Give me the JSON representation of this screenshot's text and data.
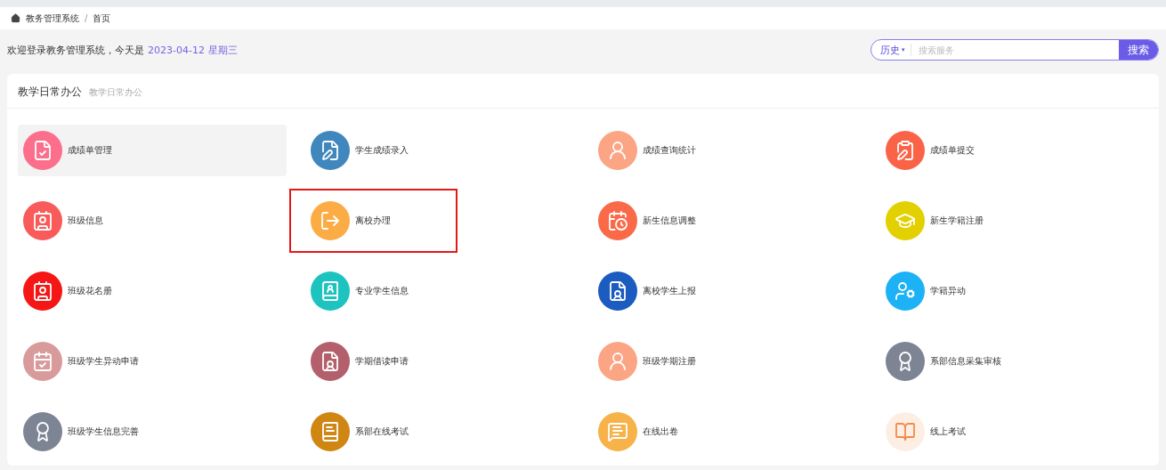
{
  "breadcrumb": [
    "教务管理系统",
    "首页"
  ],
  "breadcrumb_separator": "/",
  "welcome": {
    "text": "欢迎登录教务管理系统，今天是",
    "date": "2023-04-12",
    "weekday": "星期三"
  },
  "search": {
    "history": "历史",
    "history_caret": "▾",
    "placeholder": "搜索服务",
    "button": "搜索"
  },
  "section": {
    "title": "教学日常办公",
    "subtitle": "教学日常办公",
    "items": [
      {
        "label": "成绩单管理",
        "kind": "doc-check",
        "color": "#fb6e8c",
        "hovered": true,
        "highlighted": false
      },
      {
        "label": "学生成绩录入",
        "kind": "doc-pen",
        "color": "#3f87bd",
        "hovered": false,
        "highlighted": false
      },
      {
        "label": "成绩查询统计",
        "kind": "user-list",
        "color": "#fba584",
        "hovered": false,
        "highlighted": false
      },
      {
        "label": "成绩单提交",
        "kind": "clipboard-pen",
        "color": "#fb6349",
        "hovered": false,
        "highlighted": false
      },
      {
        "label": "班级信息",
        "kind": "contact",
        "color": "#f95a5a",
        "hovered": false,
        "highlighted": false
      },
      {
        "label": "离校办理",
        "kind": "user-exit",
        "color": "#fbac45",
        "hovered": false,
        "highlighted": true
      },
      {
        "label": "新生信息调整",
        "kind": "calendar-badge",
        "color": "#fb6a48",
        "hovered": false,
        "highlighted": false
      },
      {
        "label": "新生学籍注册",
        "kind": "graduation",
        "color": "#e2d000",
        "hovered": false,
        "highlighted": false
      },
      {
        "label": "班级花名册",
        "kind": "contact",
        "color": "#f51616",
        "hovered": false,
        "highlighted": false
      },
      {
        "label": "专业学生信息",
        "kind": "user-book",
        "color": "#1dc3bf",
        "hovered": false,
        "highlighted": false
      },
      {
        "label": "离校学生上报",
        "kind": "doc-user",
        "color": "#1c5bbf",
        "hovered": false,
        "highlighted": false
      },
      {
        "label": "学籍异动",
        "kind": "user-gear",
        "color": "#1cb2f5",
        "hovered": false,
        "highlighted": false
      },
      {
        "label": "班级学生异动申请",
        "kind": "calendar-check",
        "color": "#d89a9a",
        "hovered": false,
        "highlighted": false
      },
      {
        "label": "学期借读申请",
        "kind": "doc-user",
        "color": "#b35f6c",
        "hovered": false,
        "highlighted": false
      },
      {
        "label": "班级学期注册",
        "kind": "user-list",
        "color": "#fba584",
        "hovered": false,
        "highlighted": false
      },
      {
        "label": "系部信息采集审核",
        "kind": "award",
        "color": "#7d8494",
        "hovered": false,
        "highlighted": false
      },
      {
        "label": "班级学生信息完善",
        "kind": "award",
        "color": "#7d8494",
        "hovered": false,
        "highlighted": false
      },
      {
        "label": "系部在线考试",
        "kind": "ledger",
        "color": "#cf8612",
        "hovered": false,
        "highlighted": false
      },
      {
        "label": "在线出卷",
        "kind": "message",
        "color": "#f7b24a",
        "hovered": false,
        "highlighted": false
      },
      {
        "label": "线上考试",
        "kind": "user-book-outline",
        "color": "#fdeee4",
        "hovered": false,
        "highlighted": false
      }
    ]
  }
}
